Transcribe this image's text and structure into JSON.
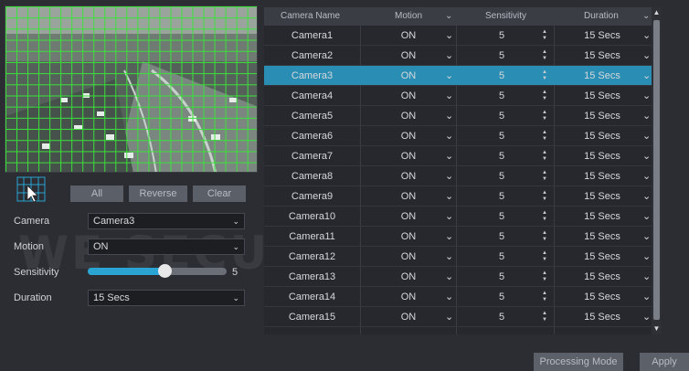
{
  "preview": {
    "grid_color": "#3ae43a"
  },
  "area_buttons": {
    "all": "All",
    "reverse": "Reverse",
    "clear": "Clear"
  },
  "form": {
    "camera": {
      "label": "Camera",
      "value": "Camera3"
    },
    "motion": {
      "label": "Motion",
      "value": "ON"
    },
    "sensitivity": {
      "label": "Sensitivity",
      "value": "5",
      "level": 0.55
    },
    "duration": {
      "label": "Duration",
      "value": "15 Secs"
    }
  },
  "table": {
    "headers": {
      "camera": "Camera Name",
      "motion": "Motion",
      "sensitivity": "Sensitivity",
      "duration": "Duration"
    },
    "selected_index": 2,
    "rows": [
      {
        "camera": "Camera1",
        "motion": "ON",
        "sensitivity": "5",
        "duration": "15 Secs"
      },
      {
        "camera": "Camera2",
        "motion": "ON",
        "sensitivity": "5",
        "duration": "15 Secs"
      },
      {
        "camera": "Camera3",
        "motion": "ON",
        "sensitivity": "5",
        "duration": "15 Secs"
      },
      {
        "camera": "Camera4",
        "motion": "ON",
        "sensitivity": "5",
        "duration": "15 Secs"
      },
      {
        "camera": "Camera5",
        "motion": "ON",
        "sensitivity": "5",
        "duration": "15 Secs"
      },
      {
        "camera": "Camera6",
        "motion": "ON",
        "sensitivity": "5",
        "duration": "15 Secs"
      },
      {
        "camera": "Camera7",
        "motion": "ON",
        "sensitivity": "5",
        "duration": "15 Secs"
      },
      {
        "camera": "Camera8",
        "motion": "ON",
        "sensitivity": "5",
        "duration": "15 Secs"
      },
      {
        "camera": "Camera9",
        "motion": "ON",
        "sensitivity": "5",
        "duration": "15 Secs"
      },
      {
        "camera": "Camera10",
        "motion": "ON",
        "sensitivity": "5",
        "duration": "15 Secs"
      },
      {
        "camera": "Camera11",
        "motion": "ON",
        "sensitivity": "5",
        "duration": "15 Secs"
      },
      {
        "camera": "Camera12",
        "motion": "ON",
        "sensitivity": "5",
        "duration": "15 Secs"
      },
      {
        "camera": "Camera13",
        "motion": "ON",
        "sensitivity": "5",
        "duration": "15 Secs"
      },
      {
        "camera": "Camera14",
        "motion": "ON",
        "sensitivity": "5",
        "duration": "15 Secs"
      },
      {
        "camera": "Camera15",
        "motion": "ON",
        "sensitivity": "5",
        "duration": "15 Secs"
      }
    ]
  },
  "footer": {
    "processing_mode": "Processing Mode",
    "apply": "Apply"
  },
  "watermark": {
    "text": "WE SECURE YOUR LIFE"
  },
  "colors": {
    "accent": "#2a8db3",
    "grid": "#3ae43a"
  }
}
